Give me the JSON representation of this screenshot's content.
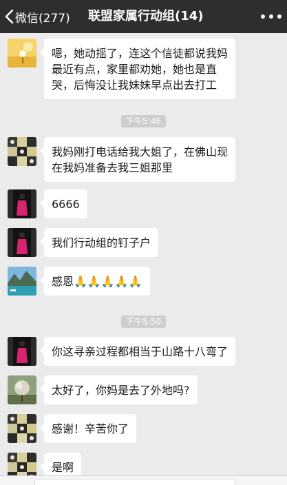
{
  "header": {
    "back_label": "微信(277)",
    "title": "联盟家属行动组(14)"
  },
  "messages": [
    {
      "avatar": "dandelion-avatar",
      "lines": [
        "嗯，她动摇了，连这个信徒都说我妈",
        "最近有点，家里都劝她，她也是直",
        "哭，后悔没让我妹妹早点出去打工"
      ]
    },
    {
      "avatar": "collage-avatar",
      "lines": [
        "我妈刚打电话给我大姐了，在佛山现",
        "在我妈准备去我三姐那里"
      ]
    },
    {
      "avatar": "red-dress-avatar",
      "lines": [
        "6666"
      ]
    },
    {
      "avatar": "red-dress-avatar",
      "lines": [
        "我们行动组的钉子户"
      ]
    },
    {
      "avatar": "lake-avatar",
      "lines": [
        "感恩🙏🙏🙏🙏🙏"
      ]
    },
    {
      "avatar": "red-dress-avatar",
      "lines": [
        "你这寻亲过程都相当于山路十八弯了"
      ]
    },
    {
      "avatar": "tree-avatar",
      "lines": [
        "太好了，你妈是去了外地吗?"
      ]
    },
    {
      "avatar": "collage-avatar",
      "lines": [
        "感谢！辛苦你了"
      ]
    },
    {
      "avatar": "collage-avatar",
      "lines": [
        "是啊"
      ]
    }
  ],
  "timestamps": [
    "下午5:46",
    "下午5:50"
  ],
  "colors": {
    "navbar": "#2e2e2e",
    "chat_background": "#ebebeb",
    "bubble": "#ffffff",
    "timestamp_bg": "#cecece"
  }
}
